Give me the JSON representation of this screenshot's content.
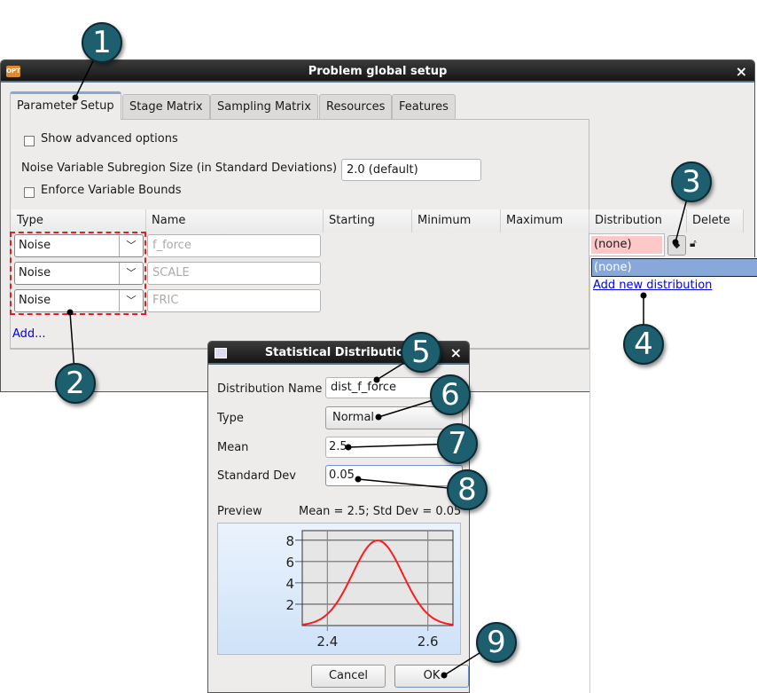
{
  "window": {
    "title": "Problem global setup",
    "close": "×",
    "icon_text": "OPT"
  },
  "tabs": [
    {
      "label": "Parameter Setup",
      "active": true
    },
    {
      "label": "Stage Matrix"
    },
    {
      "label": "Sampling Matrix"
    },
    {
      "label": "Resources"
    },
    {
      "label": "Features"
    }
  ],
  "options": {
    "show_advanced": "Show advanced options",
    "subregion_label": "Noise Variable Subregion Size (in Standard Deviations)",
    "subregion_value": "2.0 (default)",
    "enforce_bounds": "Enforce Variable Bounds"
  },
  "table": {
    "headers": [
      "Type",
      "Name",
      "Starting",
      "Minimum",
      "Maximum",
      "Distribution",
      "Delete"
    ],
    "rows": [
      {
        "type": "Noise",
        "name": "f_force",
        "distribution": "(none)"
      },
      {
        "type": "Noise",
        "name": "SCALE"
      },
      {
        "type": "Noise",
        "name": "FRIC"
      }
    ],
    "add_link": "Add..."
  },
  "dist_popup": {
    "items": [
      "(none)"
    ],
    "add_link": "Add new distribution"
  },
  "dialog": {
    "title": "Statistical Distribution",
    "close": "×",
    "name_label": "Distribution Name",
    "name_value": "dist_f_force",
    "type_label": "Type",
    "type_value": "Normal",
    "mean_label": "Mean",
    "mean_value": "2.5",
    "std_label": "Standard Dev",
    "std_value": "0.05",
    "preview_label": "Preview",
    "preview_summary": "Mean = 2.5; Std Dev = 0.05",
    "cancel": "Cancel",
    "ok": "OK"
  },
  "chart_data": {
    "type": "line",
    "title": "",
    "xlabel": "",
    "ylabel": "",
    "distribution": "normal",
    "mean": 2.5,
    "std": 0.05,
    "xlim": [
      2.35,
      2.65
    ],
    "ylim": [
      0,
      8.9
    ],
    "xticks": [
      "2.4",
      "2.6"
    ],
    "yticks": [
      "2",
      "4",
      "6",
      "8"
    ],
    "grid": true,
    "colors": {
      "line": "#ff1a1a",
      "plot_bg": "#e6e6e6"
    }
  },
  "callouts": [
    "1",
    "2",
    "3",
    "4",
    "5",
    "6",
    "7",
    "8",
    "9"
  ],
  "colors": {
    "callout": "#1d5f6f",
    "highlight_dash": "#e02020",
    "selection": "#87a8d8",
    "invalid": "#ffc8c8",
    "link": "#0000ee"
  }
}
